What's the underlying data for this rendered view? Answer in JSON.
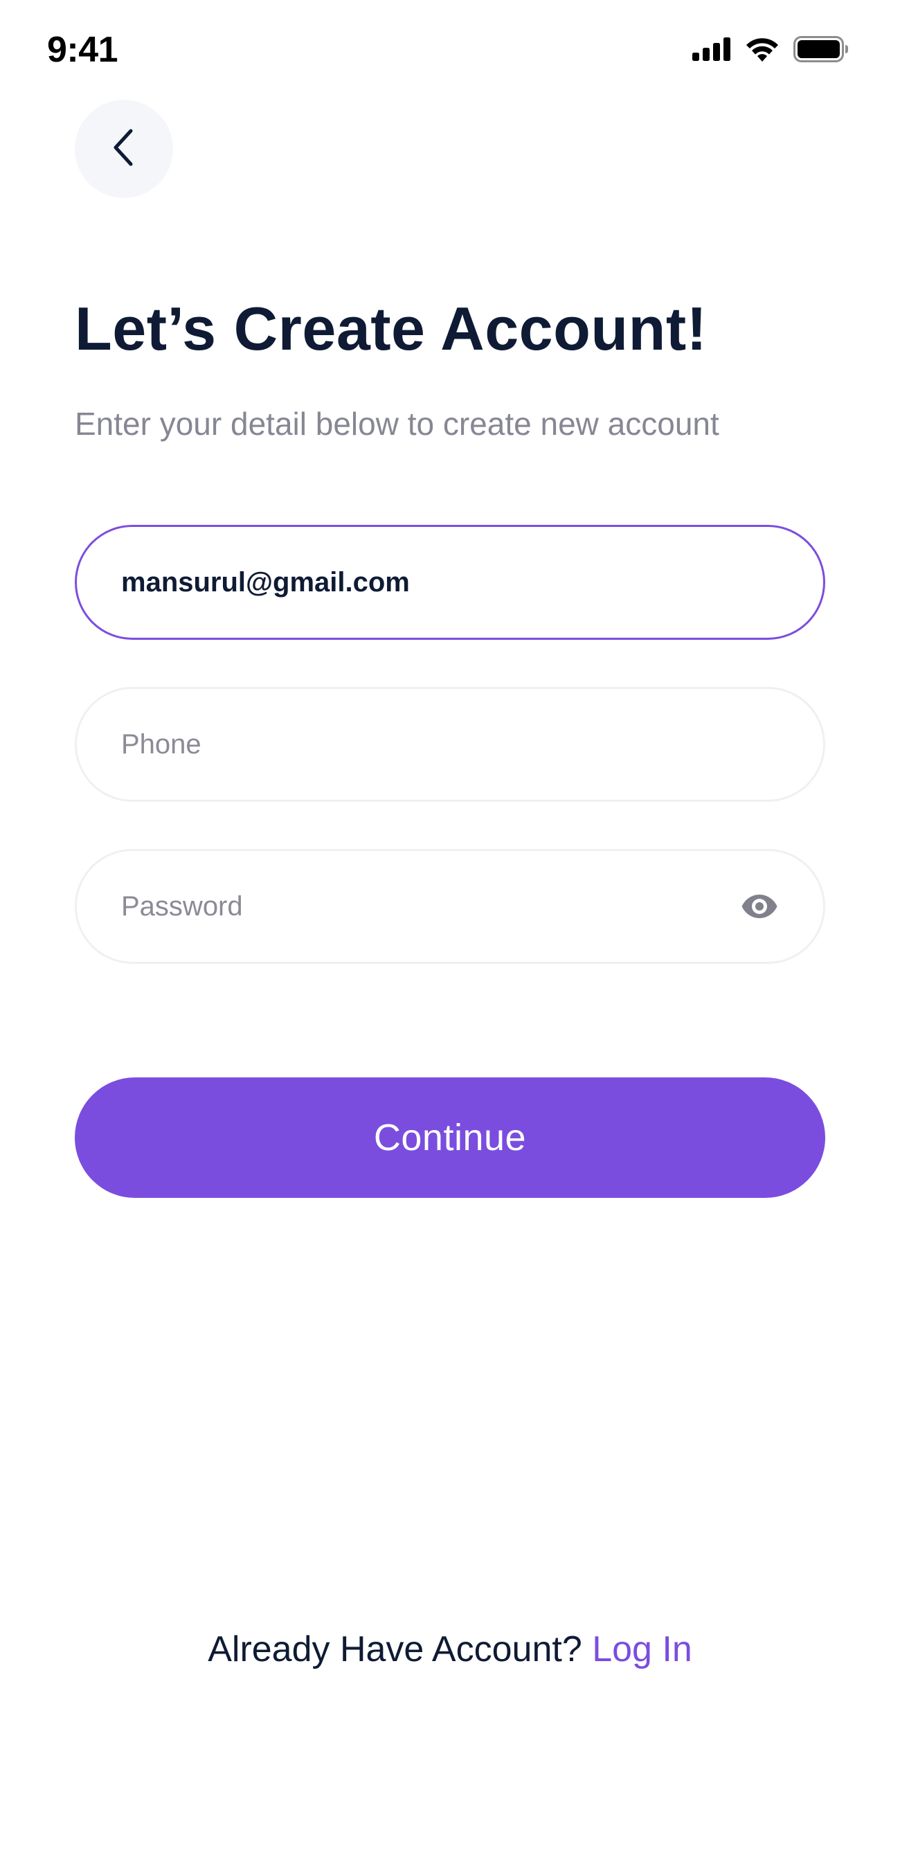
{
  "status_bar": {
    "time": "9:41",
    "icons": [
      "cellular-signal-icon",
      "wifi-icon",
      "battery-icon"
    ]
  },
  "header": {
    "back_icon": "chevron-left-icon"
  },
  "main": {
    "title": "Let’s Create Account!",
    "subtitle": "Enter your detail below to create new account",
    "email": {
      "value": "mansurul@gmail.com"
    },
    "phone": {
      "placeholder": "Phone"
    },
    "password": {
      "placeholder": "Password",
      "toggle_icon": "eye-icon"
    },
    "continue_label": "Continue"
  },
  "footer": {
    "prompt": "Already Have Account?",
    "link_label": "Log In"
  },
  "colors": {
    "accent": "#7a4ddf",
    "title": "#0f1b35",
    "muted": "#868793",
    "field_border": "#f0f0f3"
  }
}
